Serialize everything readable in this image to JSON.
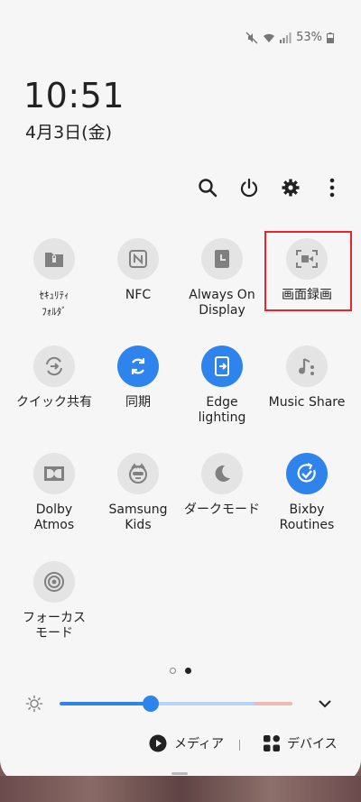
{
  "status_bar": {
    "battery": "53%"
  },
  "clock": {
    "time": "10:51",
    "date": "4月3日(金)"
  },
  "header_actions": [
    "search-icon",
    "power-icon",
    "gear-icon",
    "more-icon"
  ],
  "tiles": [
    {
      "label": "ｾｷｭﾘﾃｨ\nﾌｫﾙﾀﾞ",
      "icon": "secure-folder-icon",
      "active": false
    },
    {
      "label": "NFC",
      "icon": "nfc-icon",
      "active": false
    },
    {
      "label": "Always On\nDisplay",
      "icon": "always-on-display-icon",
      "active": false
    },
    {
      "label": "画面録画",
      "icon": "screen-record-icon",
      "active": false
    },
    {
      "label": "クイック共有",
      "icon": "quick-share-icon",
      "active": false
    },
    {
      "label": "同期",
      "icon": "sync-icon",
      "active": true
    },
    {
      "label": "Edge\nlighting",
      "icon": "edge-lighting-icon",
      "active": true
    },
    {
      "label": "Music Share",
      "icon": "music-share-icon",
      "active": false
    },
    {
      "label": "Dolby\nAtmos",
      "icon": "dolby-atmos-icon",
      "active": false
    },
    {
      "label": "Samsung\nKids",
      "icon": "samsung-kids-icon",
      "active": false
    },
    {
      "label": "ダークモード",
      "icon": "dark-mode-icon",
      "active": false
    },
    {
      "label": "Bixby\nRoutines",
      "icon": "bixby-routines-icon",
      "active": true
    },
    {
      "label": "フォーカス\nモード",
      "icon": "focus-mode-icon",
      "active": false
    }
  ],
  "pager": {
    "current": 2,
    "total": 2
  },
  "brightness": {
    "level": 0.39
  },
  "media_bar": {
    "media_label": "メディア",
    "devices_label": "デバイス"
  },
  "colors": {
    "accent": "#2f83ec",
    "highlight": "#e5262b",
    "panel": "#f6f6f6"
  }
}
